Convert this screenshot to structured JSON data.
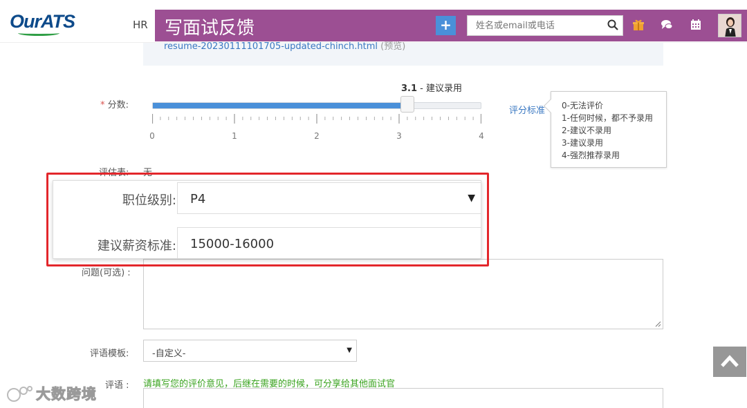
{
  "header": {
    "logo": "OurATS",
    "hr_link": "HR",
    "page_title": "写面试反馈",
    "plus_label": "+",
    "search_placeholder": "姓名或email或电话",
    "accent_color": "#9c4f93",
    "icons": [
      "plus-icon",
      "search-icon",
      "gift-icon",
      "chat-icon",
      "calendar-icon",
      "avatar"
    ]
  },
  "resume": {
    "link_text": "resume-20230111101705-updated-chinch.html",
    "note": "(预览)"
  },
  "score": {
    "label": "分数:",
    "required_mark": "*",
    "value": "3.1",
    "value_text": "- 建议录用",
    "min": 0,
    "max": 4,
    "current": 3.1,
    "tick_labels": [
      "0",
      "1",
      "2",
      "3",
      "4"
    ]
  },
  "criteria": {
    "link": "评分标准",
    "items": [
      "0-无法评价",
      "1-任何时候，都不予录用",
      "2-建议不录用",
      "3-建议录用",
      "4-强烈推荐录用"
    ]
  },
  "evaluation": {
    "label": "评估表:",
    "value": "无"
  },
  "zoom": {
    "level_label": "职位级别:",
    "level_value": "P4",
    "salary_label": "建议薪资标准:",
    "salary_value": "15000-16000",
    "highlight_color": "#e3262b"
  },
  "questions": {
    "label": "问题(可选) :"
  },
  "template": {
    "label": "评语模板:",
    "selected": "-自定义-"
  },
  "comment": {
    "label": "评语 :",
    "hint": "请填写您的评价意见，后继在需要的时候，可分享给其他面试官"
  },
  "watermark": "大数跨境"
}
